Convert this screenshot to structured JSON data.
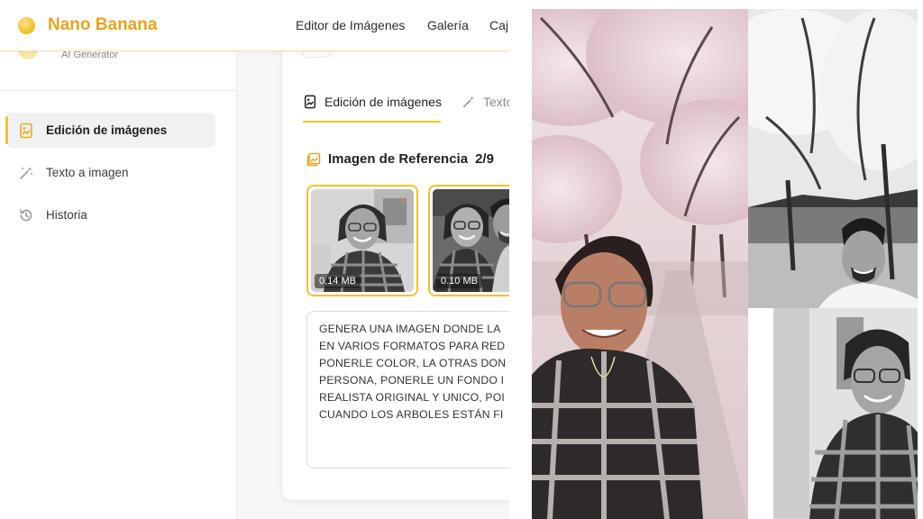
{
  "header": {
    "logo_text": "Nano Banana",
    "nav": [
      "Editor de Imágenes",
      "Galería",
      "Caj"
    ]
  },
  "sidebar": {
    "brand_subtitle": "AI Generator",
    "items": [
      {
        "label": "Edición de imágenes",
        "icon": "image-edit-icon",
        "active": true
      },
      {
        "label": "Texto a imagen",
        "icon": "magic-wand-icon",
        "active": false
      },
      {
        "label": "Historia",
        "icon": "history-icon",
        "active": false
      }
    ]
  },
  "main": {
    "tabs": [
      {
        "label": "Edición de imágenes",
        "icon": "image-edit-icon",
        "active": true
      },
      {
        "label": "Texto",
        "icon": "magic-wand-icon",
        "active": false
      }
    ],
    "reference": {
      "title": "Imagen de Referencia",
      "count": "2/9",
      "thumbnails": [
        {
          "size": "0.14 MB"
        },
        {
          "size": "0.10 MB"
        }
      ]
    },
    "prompt_lines": [
      "GENERA UNA IMAGEN DONDE LA",
      "EN VARIOS FORMATOS PARA RED",
      "PONERLE  COLOR, LA OTRAS DON",
      "PERSONA, PONERLE UN FONDO I",
      "REALISTA ORIGINAL Y UNICO, POI",
      "CUANDO LOS ARBOLES ESTÁN FI"
    ]
  },
  "colors": {
    "accent": "#f2c12e",
    "brand_text": "#eba21d",
    "blossom": "#e7d3d8"
  }
}
